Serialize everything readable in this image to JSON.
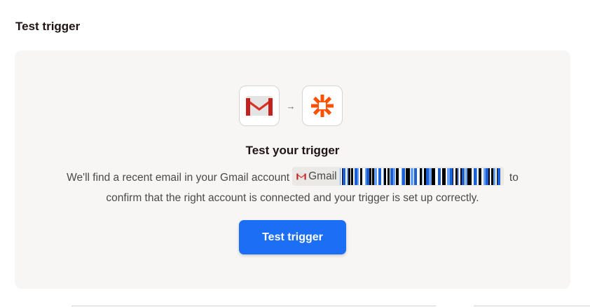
{
  "section": {
    "title": "Test trigger"
  },
  "card": {
    "heading": "Test your trigger",
    "description_before": "We'll find a recent email in your Gmail account",
    "account_chip": {
      "app_name": "Gmail",
      "icon": "gmail-icon"
    },
    "description_after_line1": " to",
    "description_line2": "confirm that the right account is connected and your trigger is set up correctly.",
    "apps": [
      {
        "icon": "gmail-icon"
      },
      {
        "icon": "arrow-right-icon"
      },
      {
        "icon": "zapier-icon"
      }
    ],
    "button_label": "Test trigger"
  },
  "colors": {
    "accent": "#1c6ef5",
    "card_background": "#f7f6f5",
    "zapier_orange": "#ff4f00",
    "gmail_red": "#d93025"
  }
}
